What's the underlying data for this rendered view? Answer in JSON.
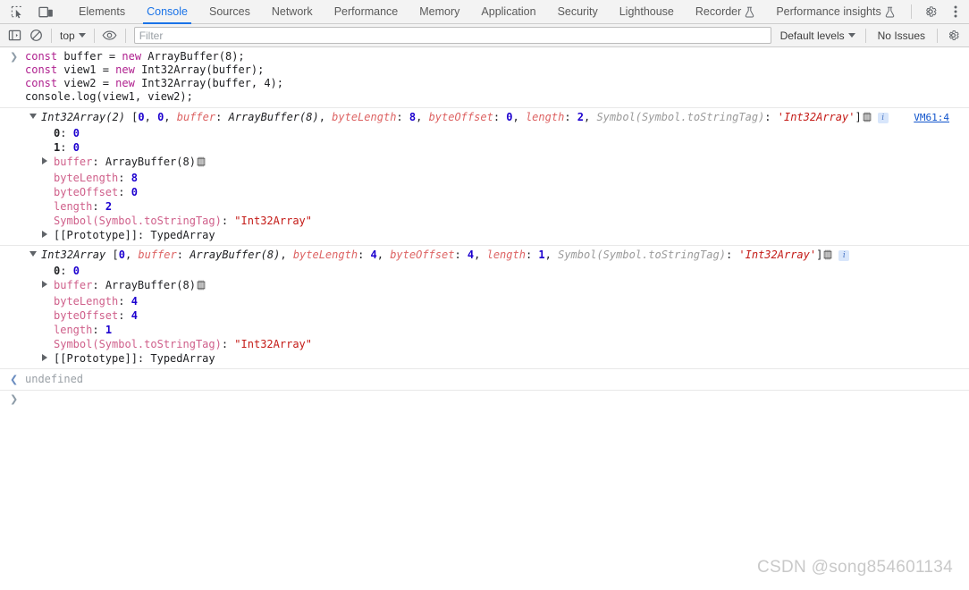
{
  "tabbar": {
    "icons": [
      {
        "name": "inspect-element-icon",
        "title": "Inspect"
      },
      {
        "name": "device-toolbar-icon",
        "title": "Toggle device toolbar"
      }
    ],
    "tabs": [
      {
        "label": "Elements",
        "active": false,
        "flask": false
      },
      {
        "label": "Console",
        "active": true,
        "flask": false
      },
      {
        "label": "Sources",
        "active": false,
        "flask": false
      },
      {
        "label": "Network",
        "active": false,
        "flask": false
      },
      {
        "label": "Performance",
        "active": false,
        "flask": false
      },
      {
        "label": "Memory",
        "active": false,
        "flask": false
      },
      {
        "label": "Application",
        "active": false,
        "flask": false
      },
      {
        "label": "Security",
        "active": false,
        "flask": false
      },
      {
        "label": "Lighthouse",
        "active": false,
        "flask": false
      },
      {
        "label": "Recorder",
        "active": false,
        "flask": true
      },
      {
        "label": "Performance insights",
        "active": false,
        "flask": true
      }
    ],
    "right_buttons": [
      {
        "name": "settings-gear-icon"
      },
      {
        "name": "more-options-icon"
      }
    ],
    "accent_color": "#1a73e8"
  },
  "filterbar": {
    "sidebar_toggle": "console-sidebar-icon",
    "clear_console": "clear-console-icon",
    "context": "top",
    "eye_icon": "live-expression-icon",
    "filter_placeholder": "Filter",
    "filter_value": "",
    "levels_label": "Default levels",
    "issues_label": "No Issues",
    "settings_icon": "console-settings-icon"
  },
  "console": {
    "input": {
      "lines": [
        [
          {
            "t": "const",
            "c": "kw"
          },
          {
            "t": " buffer = ",
            "c": "plain"
          },
          {
            "t": "new",
            "c": "kw"
          },
          {
            "t": " ArrayBuffer(8);",
            "c": "plain"
          }
        ],
        [
          {
            "t": "const",
            "c": "kw"
          },
          {
            "t": " view1 = ",
            "c": "plain"
          },
          {
            "t": "new",
            "c": "kw"
          },
          {
            "t": " Int32Array(buffer);",
            "c": "plain"
          }
        ],
        [
          {
            "t": "const",
            "c": "kw"
          },
          {
            "t": " view2 = ",
            "c": "plain"
          },
          {
            "t": "new",
            "c": "kw"
          },
          {
            "t": " Int32Array(buffer, 4);",
            "c": "plain"
          }
        ],
        [
          {
            "t": "console.log(view1, view2);",
            "c": "plain"
          }
        ]
      ]
    },
    "results": [
      {
        "source_link": "VM61:4",
        "header": [
          {
            "t": "Int32Array(2)",
            "c": "ctor"
          },
          {
            "t": " [",
            "c": "punct"
          },
          {
            "t": "0",
            "c": "num"
          },
          {
            "t": ", ",
            "c": "punct"
          },
          {
            "t": "0",
            "c": "num"
          },
          {
            "t": ", ",
            "c": "punct"
          },
          {
            "t": "buffer",
            "c": "propname"
          },
          {
            "t": ": ",
            "c": "punct"
          },
          {
            "t": "ArrayBuffer(8)",
            "c": "ctor"
          },
          {
            "t": ", ",
            "c": "punct"
          },
          {
            "t": "byteLength",
            "c": "propname"
          },
          {
            "t": ": ",
            "c": "punct"
          },
          {
            "t": "8",
            "c": "num"
          },
          {
            "t": ", ",
            "c": "punct"
          },
          {
            "t": "byteOffset",
            "c": "propname"
          },
          {
            "t": ": ",
            "c": "punct"
          },
          {
            "t": "0",
            "c": "num"
          },
          {
            "t": ", ",
            "c": "punct"
          },
          {
            "t": "length",
            "c": "propname"
          },
          {
            "t": ": ",
            "c": "punct"
          },
          {
            "t": "2",
            "c": "num"
          },
          {
            "t": ", ",
            "c": "punct"
          },
          {
            "t": "Symbol(Symbol.toStringTag)",
            "c": "sym"
          },
          {
            "t": ": ",
            "c": "punct"
          },
          {
            "t": "'Int32Array'",
            "c": "str"
          },
          {
            "t": "]",
            "c": "punct"
          }
        ],
        "props": [
          {
            "tri": "none",
            "name": "0",
            "nc": "pname-idx",
            "value": "0",
            "vc": "pval-num"
          },
          {
            "tri": "none",
            "name": "1",
            "nc": "pname-idx",
            "value": "0",
            "vc": "pval-num"
          },
          {
            "tri": "closed",
            "name": "buffer",
            "nc": "pname",
            "value": "ArrayBuffer(8)",
            "vc": "pval-plain",
            "chip": true
          },
          {
            "tri": "none",
            "name": "byteLength",
            "nc": "pname",
            "value": "8",
            "vc": "pval-num"
          },
          {
            "tri": "none",
            "name": "byteOffset",
            "nc": "pname",
            "value": "0",
            "vc": "pval-num"
          },
          {
            "tri": "none",
            "name": "length",
            "nc": "pname",
            "value": "2",
            "vc": "pval-num"
          },
          {
            "tri": "none",
            "name": "Symbol(Symbol.toStringTag)",
            "nc": "pname",
            "value": "\"Int32Array\"",
            "vc": "pval-str"
          },
          {
            "tri": "closed",
            "name": "[[Prototype]]",
            "nc": "pval-plain",
            "value": "TypedArray",
            "vc": "pval-plain"
          }
        ]
      },
      {
        "source_link": "",
        "header": [
          {
            "t": "Int32Array",
            "c": "ctor"
          },
          {
            "t": " [",
            "c": "punct"
          },
          {
            "t": "0",
            "c": "num"
          },
          {
            "t": ", ",
            "c": "punct"
          },
          {
            "t": "buffer",
            "c": "propname"
          },
          {
            "t": ": ",
            "c": "punct"
          },
          {
            "t": "ArrayBuffer(8)",
            "c": "ctor"
          },
          {
            "t": ", ",
            "c": "punct"
          },
          {
            "t": "byteLength",
            "c": "propname"
          },
          {
            "t": ": ",
            "c": "punct"
          },
          {
            "t": "4",
            "c": "num"
          },
          {
            "t": ", ",
            "c": "punct"
          },
          {
            "t": "byteOffset",
            "c": "propname"
          },
          {
            "t": ": ",
            "c": "punct"
          },
          {
            "t": "4",
            "c": "num"
          },
          {
            "t": ", ",
            "c": "punct"
          },
          {
            "t": "length",
            "c": "propname"
          },
          {
            "t": ": ",
            "c": "punct"
          },
          {
            "t": "1",
            "c": "num"
          },
          {
            "t": ", ",
            "c": "punct"
          },
          {
            "t": "Symbol(Symbol.toStringTag)",
            "c": "sym"
          },
          {
            "t": ": ",
            "c": "punct"
          },
          {
            "t": "'Int32Array'",
            "c": "str"
          },
          {
            "t": "]",
            "c": "punct"
          }
        ],
        "props": [
          {
            "tri": "none",
            "name": "0",
            "nc": "pname-idx",
            "value": "0",
            "vc": "pval-num"
          },
          {
            "tri": "closed",
            "name": "buffer",
            "nc": "pname",
            "value": "ArrayBuffer(8)",
            "vc": "pval-plain",
            "chip": true
          },
          {
            "tri": "none",
            "name": "byteLength",
            "nc": "pname",
            "value": "4",
            "vc": "pval-num"
          },
          {
            "tri": "none",
            "name": "byteOffset",
            "nc": "pname",
            "value": "4",
            "vc": "pval-num"
          },
          {
            "tri": "none",
            "name": "length",
            "nc": "pname",
            "value": "1",
            "vc": "pval-num"
          },
          {
            "tri": "none",
            "name": "Symbol(Symbol.toStringTag)",
            "nc": "pname",
            "value": "\"Int32Array\"",
            "vc": "pval-str"
          },
          {
            "tri": "closed",
            "name": "[[Prototype]]",
            "nc": "pval-plain",
            "value": "TypedArray",
            "vc": "pval-plain"
          }
        ]
      }
    ],
    "return_value": "undefined",
    "prompt_symbol": ">"
  },
  "watermark": "CSDN @song854601134"
}
